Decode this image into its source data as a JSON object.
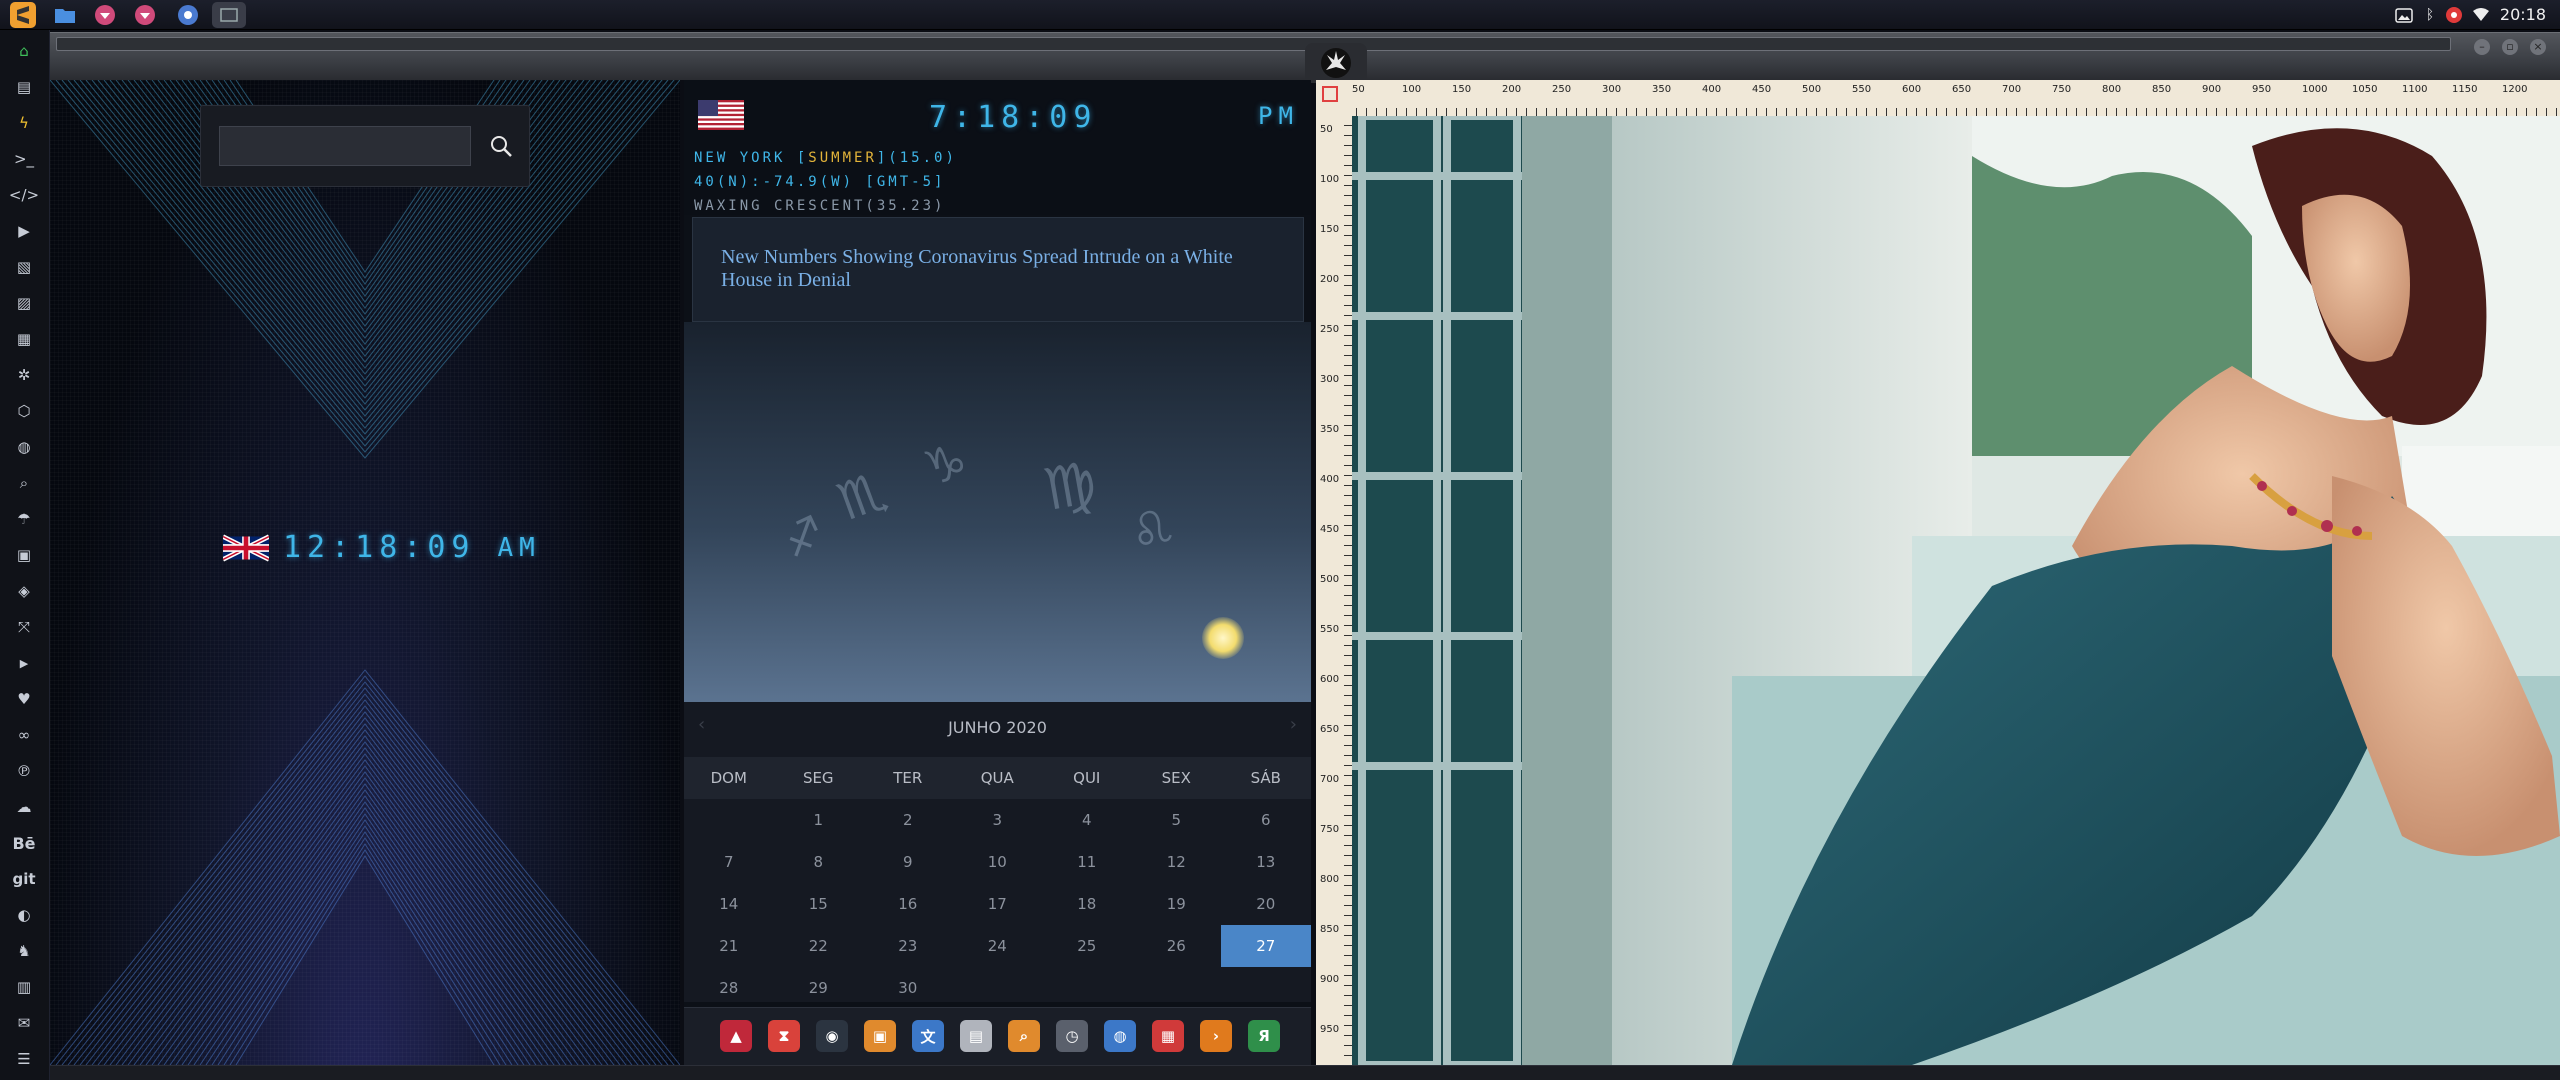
{
  "top_panel": {
    "launchers": [
      "sublime-text-icon",
      "folder-icon",
      "pink-app-icon",
      "pink-app-2-icon",
      "chrome-icon",
      "window-icon"
    ],
    "tray": [
      "image-icon",
      "bluetooth-icon",
      "settings-red-icon",
      "wifi-icon"
    ],
    "clock": "20:18"
  },
  "left_dock": {
    "items": [
      "home-icon",
      "document-icon",
      "bolt-icon",
      "terminal-icon",
      "code-icon",
      "play-icon",
      "pdf-icon",
      "image-icon",
      "news-icon",
      "star-icon",
      "hexagon-icon",
      "globe-icon",
      "search-icon",
      "umbrella-icon",
      "contacts-icon",
      "tag-icon",
      "expand-icon",
      "youtube-icon",
      "heart-icon",
      "infinity-icon",
      "pinterest-icon",
      "cloud-icon",
      "behance-icon",
      "git-icon",
      "github-icon",
      "users-icon",
      "map-icon",
      "mail-icon",
      "server-icon"
    ],
    "behance_label": "Bē",
    "git_label": "git"
  },
  "geo_panel": {
    "search_placeholder": "",
    "uk_time": "12:18:09",
    "uk_ampm": "AM"
  },
  "world_panel": {
    "ny_time": "7:18:09",
    "ny_ampm": "PM",
    "line1_prefix": "NEW YORK [",
    "line1_season": "SUMMER",
    "line1_suffix": "](15.0)",
    "line2": "40(N):-74.9(W) [GMT-5]",
    "line3": "WAXING CRESCENT(35.23)",
    "news": "New Numbers Showing Coronavirus Spread Intrude on a White House in Denial"
  },
  "calendar": {
    "title": "JUNHO 2020",
    "prev": "‹",
    "next": "›",
    "weekdays": [
      "DOM",
      "SEG",
      "TER",
      "QUA",
      "QUI",
      "SEX",
      "SÁB"
    ],
    "days": [
      "",
      "1",
      "2",
      "3",
      "4",
      "5",
      "6",
      "7",
      "8",
      "9",
      "10",
      "11",
      "12",
      "13",
      "14",
      "15",
      "16",
      "17",
      "18",
      "19",
      "20",
      "21",
      "22",
      "23",
      "24",
      "25",
      "26",
      "27",
      "28",
      "29",
      "30"
    ],
    "today": "27"
  },
  "bottom_dock": {
    "items": [
      {
        "name": "arch-icon",
        "glyph": "▲",
        "color": "#c0283a"
      },
      {
        "name": "hourglass-icon",
        "glyph": "⧗",
        "color": "#d9423b"
      },
      {
        "name": "earth-icon",
        "glyph": "◉",
        "color": "#2b3440"
      },
      {
        "name": "photos-icon",
        "glyph": "▣",
        "color": "#e08a2d"
      },
      {
        "name": "translate-icon",
        "glyph": "文",
        "color": "#3c78c8"
      },
      {
        "name": "news-reader-icon",
        "glyph": "▤",
        "color": "#b0b4bc"
      },
      {
        "name": "magnifier-icon",
        "glyph": "⌕",
        "color": "#e08a2d"
      },
      {
        "name": "clock-icon",
        "glyph": "◷",
        "color": "#5a606c"
      },
      {
        "name": "web-icon",
        "glyph": "◍",
        "color": "#3c78c8"
      },
      {
        "name": "calendar-icon",
        "glyph": "▦",
        "color": "#d03a3a"
      },
      {
        "name": "arrow-icon",
        "glyph": "›",
        "color": "#e07a1d"
      },
      {
        "name": "yandex-icon",
        "glyph": "Я",
        "color": "#2f8f4a"
      }
    ]
  },
  "photo_panel": {
    "ruler_top": [
      "50",
      "100",
      "150",
      "200",
      "250",
      "300",
      "350",
      "400",
      "450",
      "500",
      "550",
      "600",
      "650",
      "700",
      "750",
      "800",
      "850",
      "900",
      "950",
      "1000",
      "1050",
      "1100",
      "1150",
      "1200"
    ],
    "ruler_left": [
      "50",
      "100",
      "150",
      "200",
      "250",
      "300",
      "350",
      "400",
      "450",
      "500",
      "550",
      "600",
      "650",
      "700",
      "750",
      "800",
      "850",
      "900",
      "950"
    ]
  }
}
